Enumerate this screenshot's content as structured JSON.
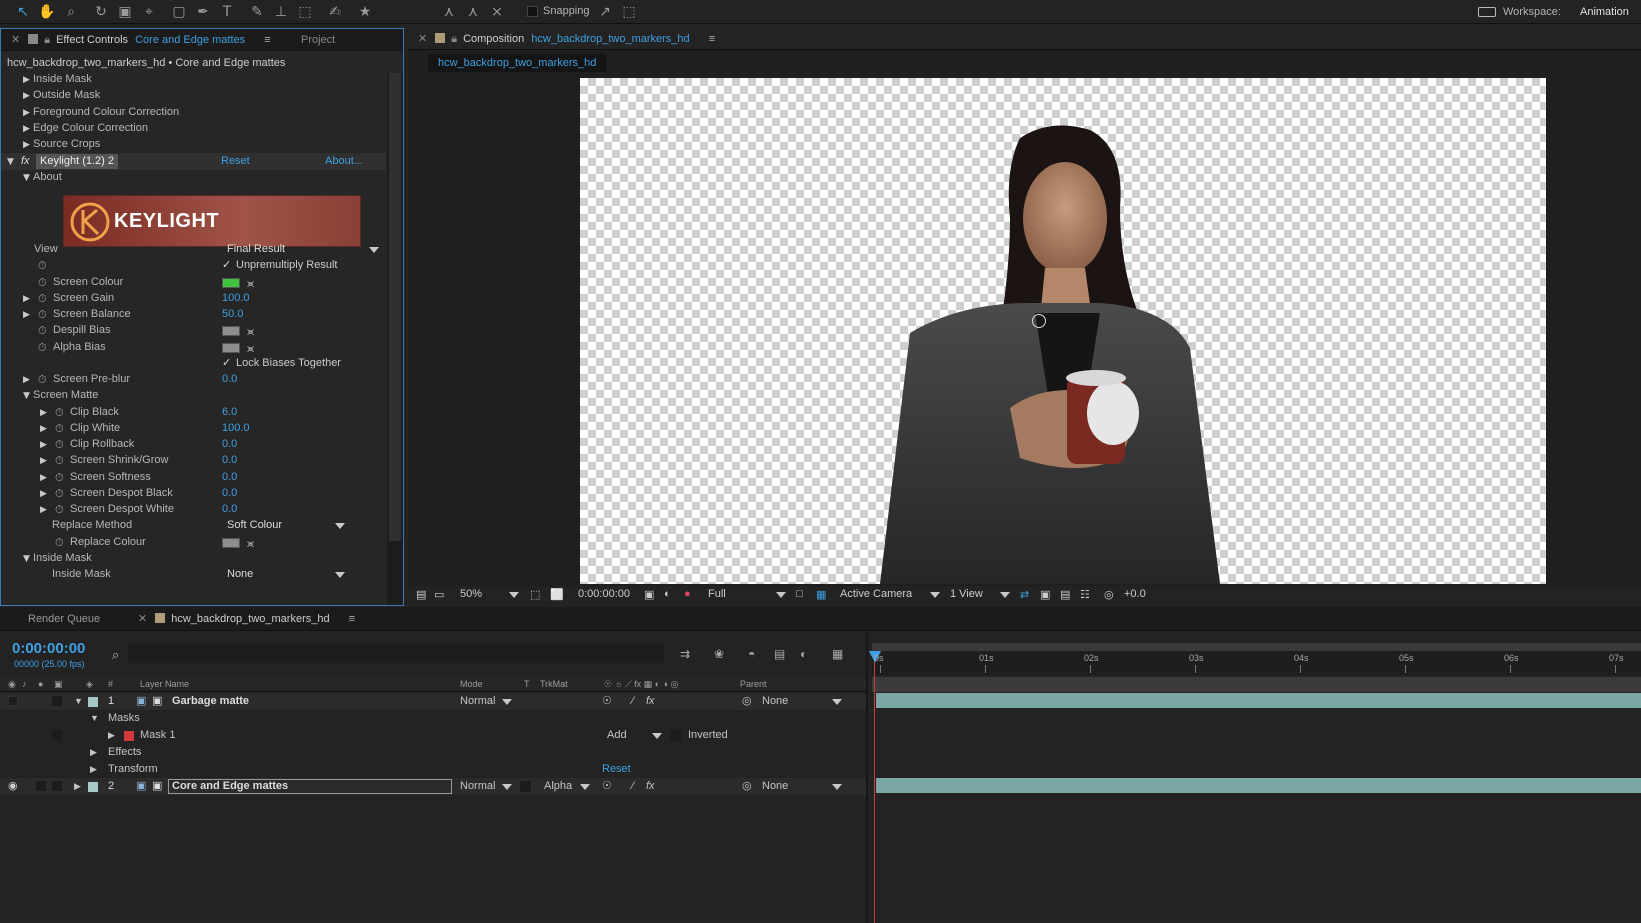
{
  "toolbar": {
    "snapping_label": "Snapping",
    "workspace_label": "Workspace:",
    "workspace_value": "Animation"
  },
  "effect_controls": {
    "tab_label": "Effect Controls",
    "tab_layer": "Core and Edge mattes",
    "project_tab": "Project",
    "breadcrumb": "hcw_backdrop_two_markers_hd • Core and Edge mattes",
    "rows": {
      "inside_mask_1": "Inside Mask",
      "outside_mask": "Outside Mask",
      "fg_colour": "Foreground Colour Correction",
      "edge_colour": "Edge Colour Correction",
      "source_crops": "Source Crops",
      "effect_name": "Keylight (1.2) 2",
      "reset": "Reset",
      "about_link": "About...",
      "about": "About",
      "logo_text": "KEYLIGHT",
      "view": "View",
      "view_value": "Final Result",
      "unpremultiply": "Unpremultiply Result",
      "screen_colour": "Screen Colour",
      "screen_gain": "Screen Gain",
      "screen_gain_val": "100.0",
      "screen_balance": "Screen Balance",
      "screen_balance_val": "50.0",
      "despill_bias": "Despill Bias",
      "alpha_bias": "Alpha Bias",
      "lock_biases": "Lock Biases Together",
      "screen_preblur": "Screen Pre-blur",
      "screen_preblur_val": "0.0",
      "screen_matte": "Screen Matte",
      "clip_black": "Clip Black",
      "clip_black_val": "6.0",
      "clip_white": "Clip White",
      "clip_white_val": "100.0",
      "clip_rollback": "Clip Rollback",
      "clip_rollback_val": "0.0",
      "shrink_grow": "Screen Shrink/Grow",
      "shrink_grow_val": "0.0",
      "softness": "Screen Softness",
      "softness_val": "0.0",
      "despot_black": "Screen Despot Black",
      "despot_black_val": "0.0",
      "despot_white": "Screen Despot White",
      "despot_white_val": "0.0",
      "replace_method": "Replace Method",
      "replace_method_val": "Soft Colour",
      "replace_colour": "Replace Colour",
      "inside_mask_2": "Inside Mask",
      "inside_mask_sub": "Inside Mask",
      "inside_mask_val": "None"
    },
    "screen_colour_hex": "#3fc33f"
  },
  "composition": {
    "tab_label": "Composition",
    "comp_name": "hcw_backdrop_two_markers_hd",
    "sub_tab": "hcw_backdrop_two_markers_hd",
    "zoom": "50%",
    "timecode": "0:00:00:00",
    "resolution": "Full",
    "camera": "Active Camera",
    "views": "1 View",
    "exposure": "+0.0"
  },
  "timeline": {
    "render_queue_tab": "Render Queue",
    "comp_tab": "hcw_backdrop_two_markers_hd",
    "timecode": "0:00:00:00",
    "fps": "00000 (25.00 fps)",
    "headers": {
      "num": "#",
      "layer_name": "Layer Name",
      "mode": "Mode",
      "t": "T",
      "trkmat": "TrkMat",
      "parent": "Parent"
    },
    "ticks": [
      "0s",
      "01s",
      "02s",
      "03s",
      "04s",
      "05s",
      "06s",
      "07s"
    ],
    "layer1": {
      "num": "1",
      "name": "Garbage matte",
      "mode": "Normal",
      "parent": "None"
    },
    "masks": "Masks",
    "mask1": {
      "name": "Mask 1",
      "mode": "Add",
      "inverted": "Inverted"
    },
    "effects": "Effects",
    "transform": "Transform",
    "transform_reset": "Reset",
    "layer2": {
      "num": "2",
      "name": "Core and Edge mattes",
      "mode": "Normal",
      "trkmat": "Alpha",
      "parent": "None"
    }
  }
}
